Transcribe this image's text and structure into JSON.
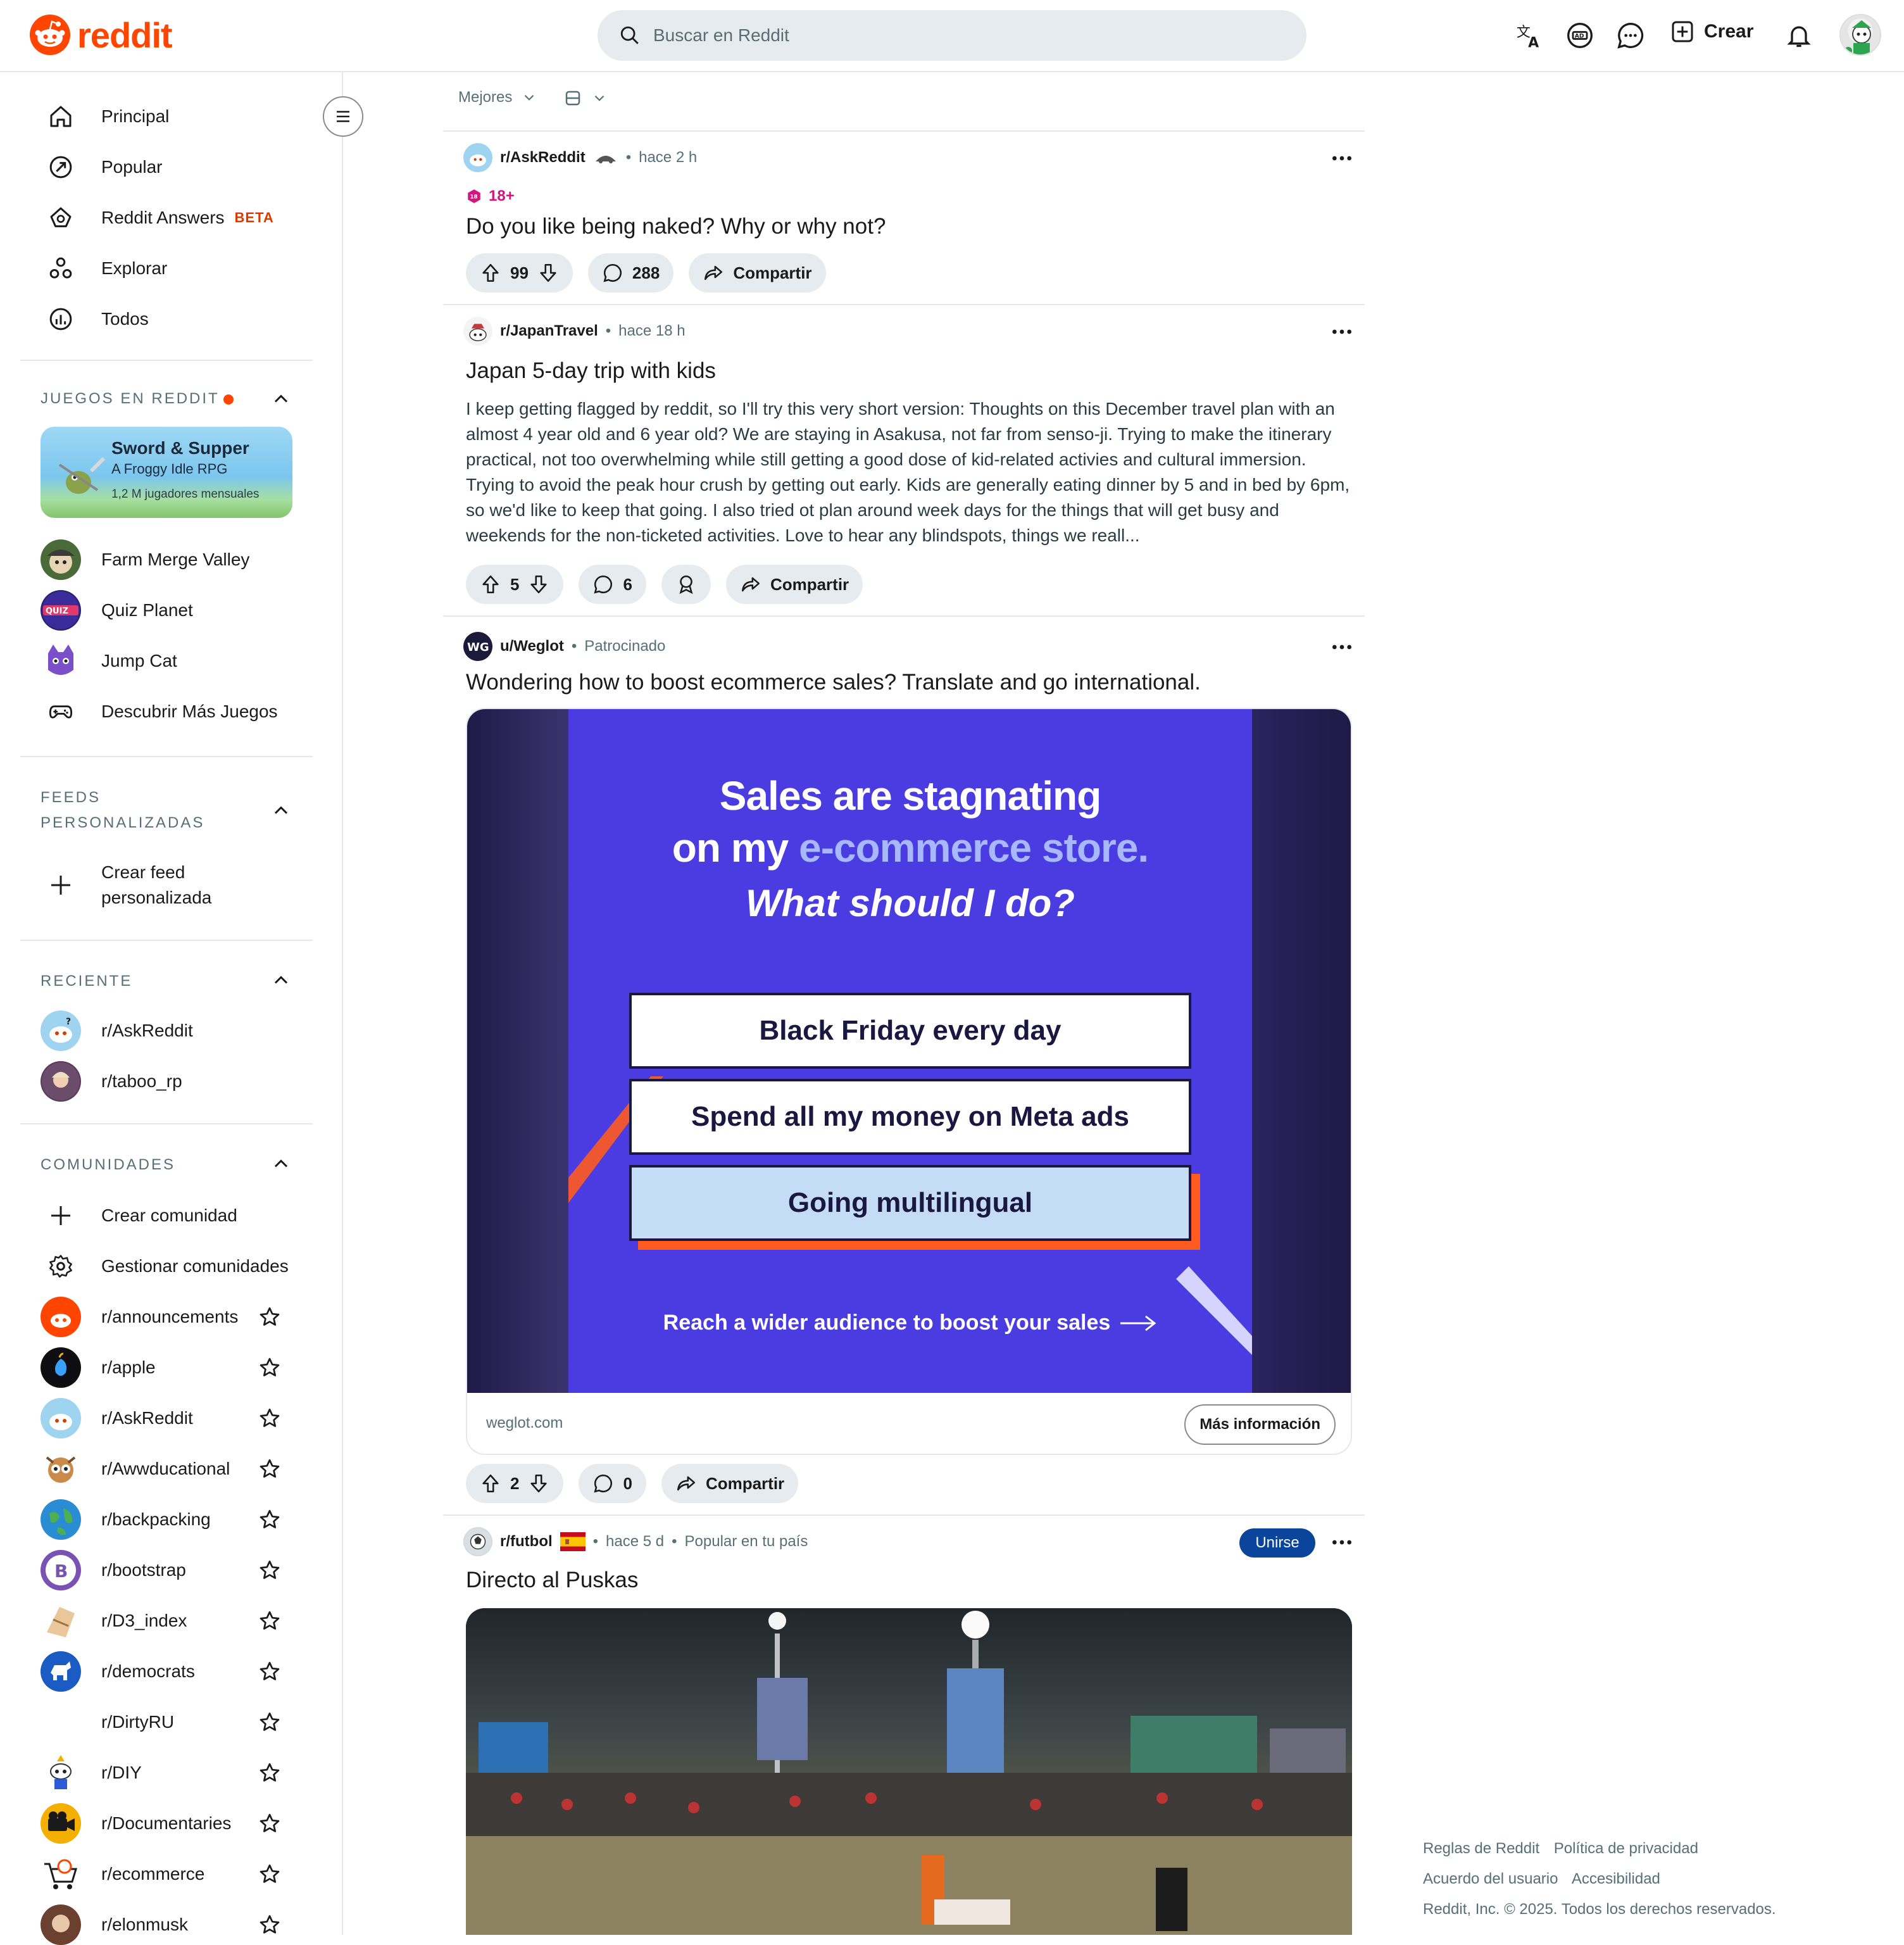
{
  "header": {
    "logo_text": "reddit",
    "search_placeholder": "Buscar en Reddit",
    "create_label": "Crear",
    "brand_color": "#ff4500"
  },
  "sidebar": {
    "nav": [
      {
        "label": "Principal",
        "icon": "home-icon"
      },
      {
        "label": "Popular",
        "icon": "popular-icon"
      },
      {
        "label": "Reddit Answers",
        "icon": "answers-icon",
        "badge": "BETA"
      },
      {
        "label": "Explorar",
        "icon": "explore-icon"
      },
      {
        "label": "Todos",
        "icon": "all-icon"
      }
    ],
    "games": {
      "title": "JUEGOS EN REDDIT",
      "featured": {
        "title": "Sword & Supper",
        "subtitle": "A Froggy Idle RPG",
        "players": "1,2 M jugadores mensuales"
      },
      "items": [
        "Farm Merge Valley",
        "Quiz Planet",
        "Jump Cat",
        "Descubrir Más Juegos"
      ]
    },
    "feeds": {
      "title_line1": "FEEDS",
      "title_line2": "PERSONALIZADAS",
      "create_line1": "Crear feed",
      "create_line2": "personalizada"
    },
    "recent": {
      "title": "RECIENTE",
      "items": [
        "r/AskReddit",
        "r/taboo_rp"
      ]
    },
    "communities": {
      "title": "COMUNIDADES",
      "create": "Crear comunidad",
      "manage": "Gestionar comunidades",
      "items": [
        "r/announcements",
        "r/apple",
        "r/AskReddit",
        "r/Awwducational",
        "r/backpacking",
        "r/bootstrap",
        "r/D3_index",
        "r/democrats",
        "r/DirtyRU",
        "r/DIY",
        "r/Documentaries",
        "r/ecommerce",
        "r/elonmusk"
      ]
    }
  },
  "feed": {
    "sort_label": "Mejores",
    "posts": [
      {
        "sub": "r/AskReddit",
        "time": "hace 2 h",
        "nsfw": "18+",
        "title": "Do you like being naked? Why or why not?",
        "votes": "99",
        "comments": "288",
        "share": "Compartir"
      },
      {
        "sub": "r/JapanTravel",
        "time": "hace 18 h",
        "title": "Japan 5-day trip with kids",
        "body": "I keep getting flagged by reddit, so I'll try this very short version: Thoughts on this December travel plan with an almost 4 year old and 6 year old? We are staying in Asakusa, not far from senso-ji. Trying to make the itinerary practical, not too overwhelming while still getting a good dose of kid-related activies and cultural immersion. Trying to avoid the peak hour crush by getting out early. Kids are generally eating dinner by 5 and in bed by 6pm, so we'd like to keep that going. I also tried ot plan around week days for the things that will get busy and weekends for the non-ticketed activities. Love to hear any blindspots, things we reall...",
        "votes": "5",
        "comments": "6",
        "share": "Compartir"
      },
      {
        "sub": "u/Weglot",
        "time": "Patrocinado",
        "title": "Wondering how to boost ecommerce sales? Translate and go international.",
        "ad": {
          "headline1": "Sales are stagnating",
          "headline2_a": "on my ",
          "headline2_b": "e-commerce store.",
          "question": "What should I do?",
          "options": [
            "Black Friday every day",
            "Spend all my money on Meta ads",
            "Going multilingual"
          ],
          "cta": "Reach a wider audience to boost your sales",
          "domain": "weglot.com",
          "more": "Más información",
          "bg_color": "#4a3ce0",
          "accent_color": "#ff5a1f"
        },
        "votes": "2",
        "comments": "0",
        "share": "Compartir"
      },
      {
        "sub": "r/futbol",
        "time": "hace 5 d",
        "extra": "Popular en tu país",
        "join": "Unirse",
        "title": "Directo al Puskas"
      }
    ]
  },
  "footer": {
    "links_row1": [
      "Reglas de Reddit",
      "Política de privacidad"
    ],
    "links_row2": [
      "Acuerdo del usuario",
      "Accesibilidad"
    ],
    "copyright": "Reddit, Inc. © 2025. Todos los derechos reservados."
  }
}
